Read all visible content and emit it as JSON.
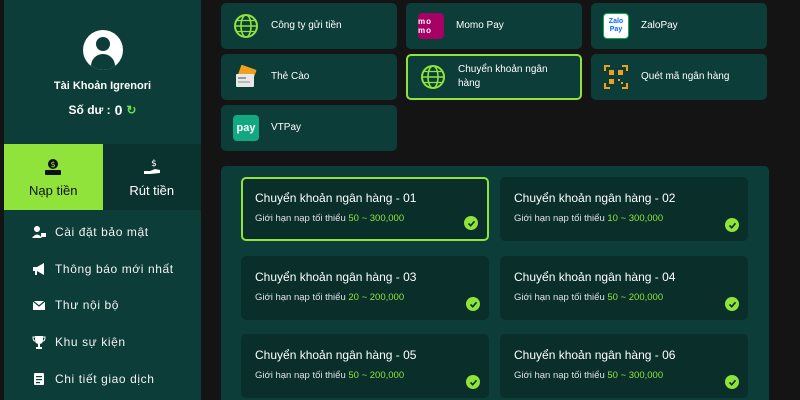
{
  "account": {
    "name": "Tài Khoản Igrenori",
    "balance_label": "Số dư :",
    "balance_value": "0"
  },
  "fund_tabs": [
    {
      "label": "Nạp tiền",
      "icon": "wallet-icon",
      "active": true
    },
    {
      "label": "Rút tiền",
      "icon": "hand-dollar-icon",
      "active": false
    }
  ],
  "menu": [
    {
      "label": "Cài đặt bảo mật",
      "icon": "user-lock-icon"
    },
    {
      "label": "Thông báo mới nhất",
      "icon": "megaphone-icon"
    },
    {
      "label": "Thư nội bộ",
      "icon": "mail-icon"
    },
    {
      "label": "Khu sự kiện",
      "icon": "trophy-icon"
    },
    {
      "label": "Chi tiết giao dịch",
      "icon": "list-icon"
    }
  ],
  "payment_methods": [
    {
      "label": "Công ty gửi tiền",
      "icon": "globe-icon"
    },
    {
      "label": "Momo Pay",
      "icon": "momo-icon",
      "icon_text": "mo mo"
    },
    {
      "label": "ZaloPay",
      "icon": "zalopay-icon",
      "icon_text": "Zalo Pay"
    },
    {
      "label": "Thẻ Cào",
      "icon": "card-icon"
    },
    {
      "label": "Chuyển khoản ngân hàng",
      "icon": "globe-icon",
      "active": true
    },
    {
      "label": "Quét mã ngân hàng",
      "icon": "qr-icon"
    },
    {
      "label": "VTPay",
      "icon": "vtpay-icon",
      "icon_text": "pay"
    }
  ],
  "channels": [
    {
      "title": "Chuyển khoản ngân hàng - 01",
      "limit_label": "Giới hạn nạp tối thiểu",
      "range": "50 ~ 300,000",
      "active": true
    },
    {
      "title": "Chuyển khoản ngân hàng - 02",
      "limit_label": "Giới hạn nạp tối thiểu",
      "range": "10 ~ 300,000"
    },
    {
      "title": "Chuyển khoản ngân hàng - 03",
      "limit_label": "Giới hạn nạp tối thiểu",
      "range": "20 ~ 200,000"
    },
    {
      "title": "Chuyển khoản ngân hàng - 04",
      "limit_label": "Giới hạn nạp tối thiểu",
      "range": "50 ~ 200,000"
    },
    {
      "title": "Chuyển khoản ngân hàng - 05",
      "limit_label": "Giới hạn nạp tối thiểu",
      "range": "50 ~ 200,000"
    },
    {
      "title": "Chuyển khoản ngân hàng - 06",
      "limit_label": "Giới hạn nạp tối thiểu",
      "range": "50 ~ 300,000"
    }
  ],
  "colors": {
    "accent": "#8fe33b",
    "panel": "#0d3d39",
    "card": "#0a2f2b",
    "background": "#141414"
  }
}
